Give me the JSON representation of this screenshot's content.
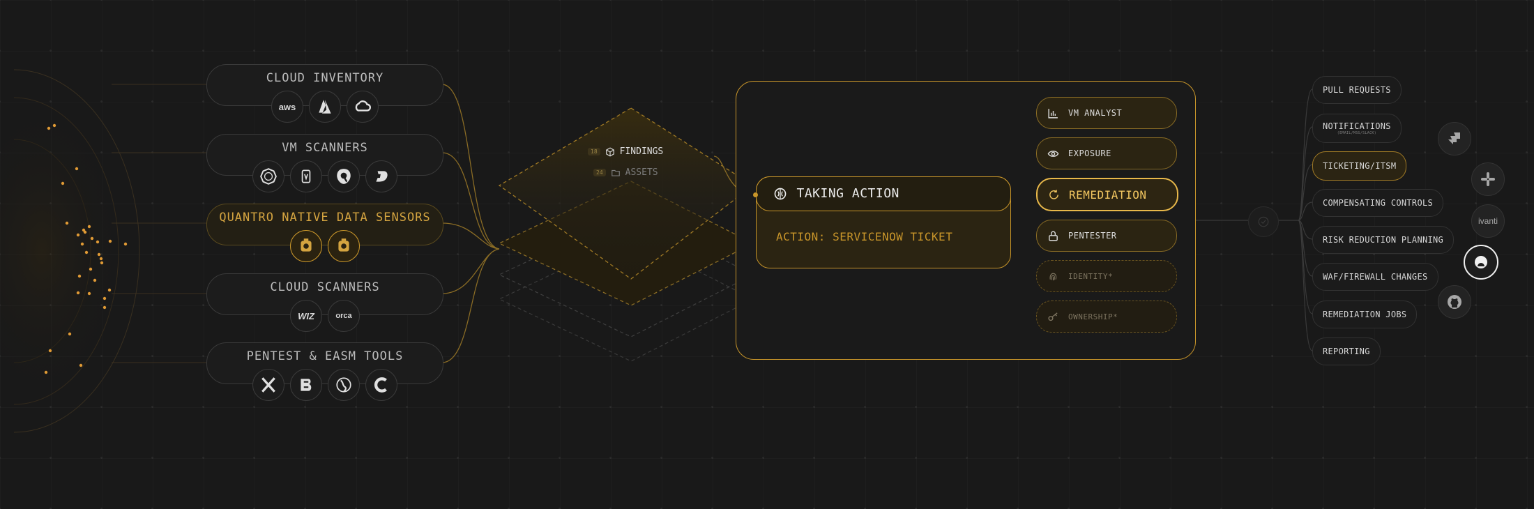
{
  "sources": [
    {
      "label": "CLOUD INVENTORY",
      "logos": [
        {
          "icon": "aws-icon",
          "text": "aws"
        },
        {
          "icon": "azure-icon",
          "text": ""
        },
        {
          "icon": "gcp-icon",
          "text": ""
        }
      ]
    },
    {
      "label": "VM SCANNERS",
      "logos": [
        {
          "icon": "tenable-icon",
          "text": ""
        },
        {
          "icon": "rapid7-icon",
          "text": ""
        },
        {
          "icon": "qualys-icon",
          "text": ""
        },
        {
          "icon": "defender-icon",
          "text": ""
        }
      ]
    },
    {
      "label": "QUANTRO NATIVE DATA SENSORS",
      "logos": [
        {
          "icon": "sensor-icon",
          "text": ""
        },
        {
          "icon": "sensor-icon",
          "text": ""
        }
      ]
    },
    {
      "label": "CLOUD SCANNERS",
      "logos": [
        {
          "icon": "wiz-icon",
          "text": "WIZ"
        },
        {
          "icon": "orca-icon",
          "text": "orca"
        }
      ]
    },
    {
      "label": "PENTEST & EASM TOOLS",
      "logos": [
        {
          "icon": "x-icon",
          "text": ""
        },
        {
          "icon": "b-icon",
          "text": ""
        },
        {
          "icon": "globe-icon",
          "text": ""
        },
        {
          "icon": "c-icon",
          "text": ""
        }
      ]
    }
  ],
  "findings": {
    "count": "18",
    "label": "FINDINGS"
  },
  "assets": {
    "count": "24",
    "label": "ASSETS"
  },
  "action": {
    "title": "TAKING ACTION",
    "subtitle": "ACTION: SERVICENOW TICKET"
  },
  "agents": [
    {
      "label": "VM ANALYST",
      "icon": "bar-chart-icon",
      "state": "normal"
    },
    {
      "label": "EXPOSURE",
      "icon": "eye-icon",
      "state": "normal"
    },
    {
      "label": "REMEDIATION",
      "icon": "refresh-icon",
      "state": "active"
    },
    {
      "label": "PENTESTER",
      "icon": "lock-icon",
      "state": "normal"
    },
    {
      "label": "IDENTITY*",
      "icon": "fingerprint-icon",
      "state": "dashed"
    },
    {
      "label": "OWNERSHIP*",
      "icon": "key-icon",
      "state": "dashed"
    }
  ],
  "outputs": [
    {
      "label": "PULL REQUESTS",
      "highlight": false
    },
    {
      "label": "NOTIFICATIONS",
      "highlight": false,
      "sub": "(EMAIL/MSG/SLACK)"
    },
    {
      "label": "TICKETING/ITSM",
      "highlight": true
    },
    {
      "label": "COMPENSATING CONTROLS",
      "highlight": false
    },
    {
      "label": "RISK REDUCTION PLANNING",
      "highlight": false
    },
    {
      "label": "WAF/FIREWALL CHANGES",
      "highlight": false
    },
    {
      "label": "REMEDIATION JOBS",
      "highlight": false
    },
    {
      "label": "REPORTING",
      "highlight": false
    }
  ],
  "integrations": [
    {
      "icon": "jira-icon",
      "text": ""
    },
    {
      "icon": "slack-icon",
      "text": ""
    },
    {
      "icon": "ivanti-icon",
      "text": "ivanti"
    },
    {
      "icon": "servicenow-icon",
      "text": ""
    },
    {
      "icon": "github-icon",
      "text": ""
    }
  ],
  "colors": {
    "accent": "#c9962a",
    "highlight": "#e8b84a",
    "background": "#191919"
  }
}
